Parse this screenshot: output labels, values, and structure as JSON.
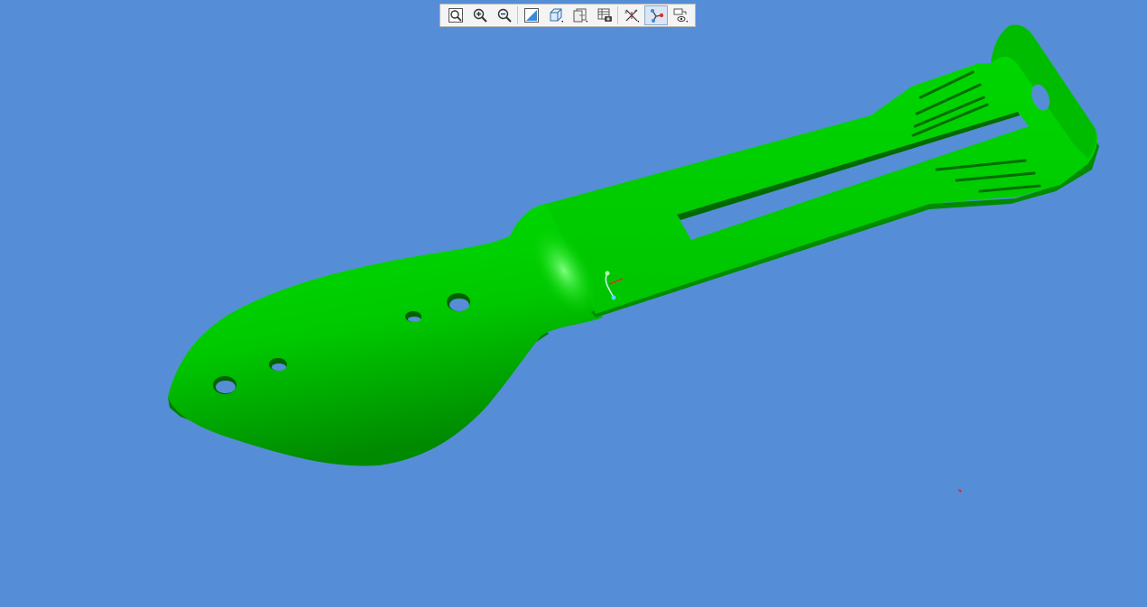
{
  "viewport": {
    "background_color": "#558ed6",
    "model_color": "#00d700",
    "model_shade_color": "#009400",
    "model_highlight_color": "#2ef02e"
  },
  "toolbar": {
    "buttons": [
      {
        "name": "refit-icon",
        "active": false
      },
      {
        "name": "zoom-in-icon",
        "active": false
      },
      {
        "name": "zoom-out-icon",
        "active": false
      },
      {
        "name": "repaint-icon",
        "active": false
      },
      {
        "name": "display-style-icon",
        "active": false
      },
      {
        "name": "saved-views-icon",
        "active": false
      },
      {
        "name": "view-manager-icon",
        "active": false
      },
      {
        "name": "datum-display-icon",
        "active": false
      },
      {
        "name": "spin-center-icon",
        "active": true
      },
      {
        "name": "annotation-display-icon",
        "active": false
      }
    ]
  }
}
